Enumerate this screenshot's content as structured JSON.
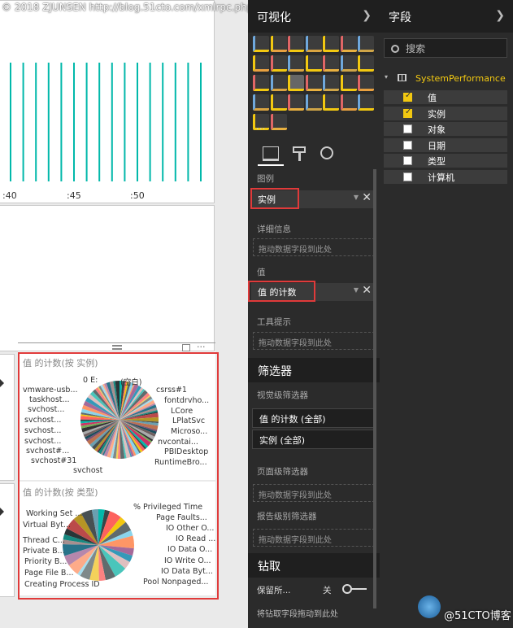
{
  "watermark": "© 2018 ZJUNSEN http://blog.51cto.com/xmlrpc.php",
  "line_chart": {
    "x_ticks": [
      ":40",
      ":45",
      ":50"
    ]
  },
  "pie1": {
    "title": "值 的计数(按 实例)",
    "labels_left": [
      "vmware-usb...",
      "taskhost...",
      "svchost...",
      "svchost...",
      "svchost...",
      "svchost...",
      "svchost#...",
      "svchost#31",
      "svchost"
    ],
    "labels_right": [
      "(空白)",
      "csrss#1",
      "fontdrvho...",
      "LCore",
      "LPlatSvc",
      "Microso...",
      "nvcontai...",
      "PBIDesktop",
      "RuntimeBro..."
    ],
    "label_top": "0 E:"
  },
  "pie2": {
    "title": "值 的计数(按 类型)",
    "labels_left": [
      "Working Set ...",
      "Virtual Byt...",
      "Thread C...",
      "Private B...",
      "Priority B...",
      "Page File B...",
      "Creating Process ID"
    ],
    "labels_right": [
      "% Privileged Time",
      "Page Faults...",
      "IO Other O...",
      "IO Read ...",
      "IO Data O...",
      "IO Write O...",
      "IO Data Byt...",
      "Pool Nonpaged..."
    ]
  },
  "viz_pane": {
    "title": "可视化",
    "more": "...",
    "sections": {
      "legend": "图例",
      "legend_value": "实例",
      "details": "详细信息",
      "details_placeholder": "拖动数据字段到此处",
      "values": "值",
      "values_value": "值 的计数",
      "tooltips": "工具提示",
      "tooltips_placeholder": "拖动数据字段到此处"
    },
    "filters": {
      "title": "筛选器",
      "visual_level": "视觉级筛选器",
      "filter1": "值 的计数 (全部)",
      "filter2": "实例 (全部)",
      "page_level": "页面级筛选器",
      "page_placeholder": "拖动数据字段到此处",
      "report_level": "报告级别筛选器",
      "report_placeholder": "拖动数据字段到此处"
    },
    "drill": {
      "title": "钻取",
      "keep_all": "保留所...",
      "toggle_label": "关",
      "placeholder": "将钻取字段拖动到此处"
    }
  },
  "fields_pane": {
    "title": "字段",
    "search_placeholder": "搜索",
    "table": "SystemPerformance",
    "fields": [
      {
        "name": "值",
        "checked": true
      },
      {
        "name": "实例",
        "checked": true
      },
      {
        "name": "对象",
        "checked": false
      },
      {
        "name": "日期",
        "checked": false
      },
      {
        "name": "类型",
        "checked": false
      },
      {
        "name": "计算机",
        "checked": false
      }
    ]
  },
  "brand": "@51CTO博客",
  "colors": {
    "accent": "#f2c811",
    "line": "#01b8aa",
    "highlight": "#e03a3a"
  }
}
